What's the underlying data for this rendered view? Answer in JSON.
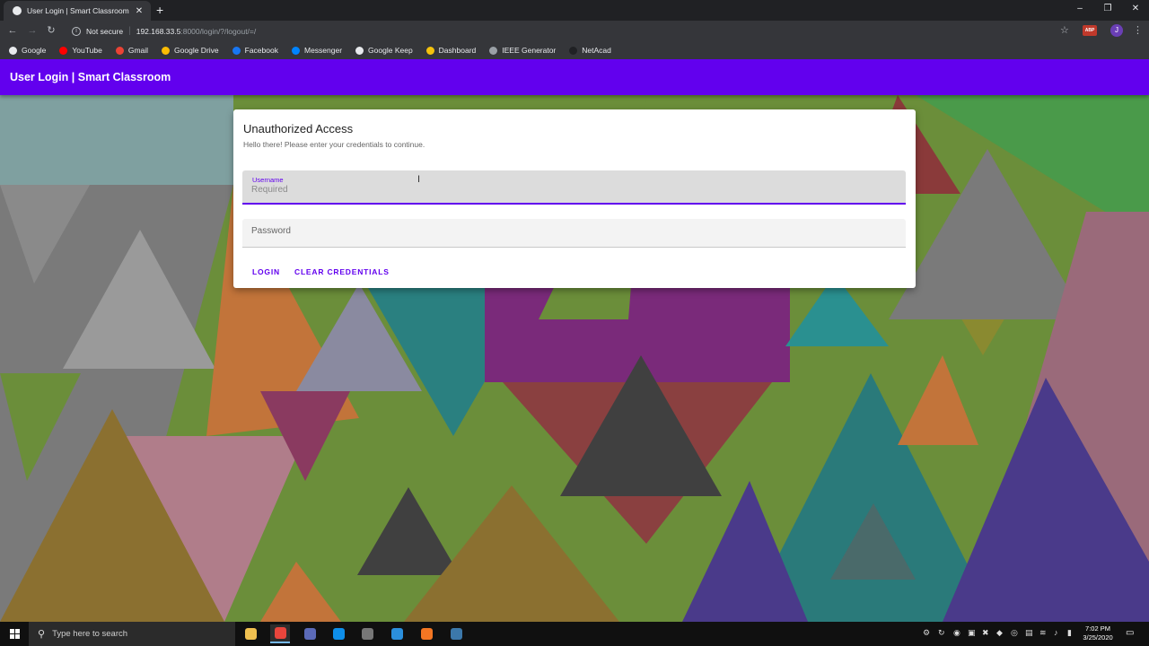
{
  "browser": {
    "tab_title": "User Login | Smart Classroom",
    "tab_close": "✕",
    "new_tab": "+",
    "window_controls": [
      "–",
      "❐",
      "✕"
    ],
    "nav": {
      "back": "←",
      "forward": "→",
      "reload": "↻"
    },
    "security_label": "Not secure",
    "url_host": "192.168.33.5",
    "url_rest": ":8000/login/?/logout/=/",
    "star": "☆",
    "extension_label": "ABP",
    "profile_initial": "J",
    "menu": "⋮",
    "bookmarks": [
      {
        "label": "Google",
        "color": "#e8eaed"
      },
      {
        "label": "YouTube",
        "color": "#ff0000"
      },
      {
        "label": "Gmail",
        "color": "#ea4335"
      },
      {
        "label": "Google Drive",
        "color": "#fbbc04"
      },
      {
        "label": "Facebook",
        "color": "#1877f2"
      },
      {
        "label": "Messenger",
        "color": "#0084ff"
      },
      {
        "label": "Google Keep",
        "color": "#e8eaed"
      },
      {
        "label": "Dashboard",
        "color": "#f4c20d"
      },
      {
        "label": "IEEE Generator",
        "color": "#9aa0a6"
      },
      {
        "label": "NetAcad",
        "color": "#202124"
      }
    ]
  },
  "app": {
    "title": "User Login | Smart Classroom",
    "accent_color": "#6200ee"
  },
  "login": {
    "heading": "Unauthorized Access",
    "subheading": "Hello there! Please enter your credentials to continue.",
    "username_label": "Username",
    "username_placeholder": "Required",
    "username_value": "",
    "password_placeholder": "Password",
    "password_value": "",
    "login_button": "LOGIN",
    "clear_button": "CLEAR CREDENTIALS"
  },
  "taskbar": {
    "search_placeholder": "Type here to search",
    "apps": [
      {
        "icon": "file-explorer-icon",
        "color": "#f0c050"
      },
      {
        "icon": "chrome-icon",
        "color": "#e8453c"
      },
      {
        "icon": "mail-icon",
        "color": "#5b6ab8"
      },
      {
        "icon": "teamviewer-icon",
        "color": "#0e8ee9"
      },
      {
        "icon": "clock-app-icon",
        "color": "#777777"
      },
      {
        "icon": "vscode-icon",
        "color": "#2b8fdc"
      },
      {
        "icon": "xampp-icon",
        "color": "#f37623"
      },
      {
        "icon": "python-icon",
        "color": "#3c78aa"
      }
    ],
    "time": "7:02 PM",
    "date": "3/25/2020"
  }
}
